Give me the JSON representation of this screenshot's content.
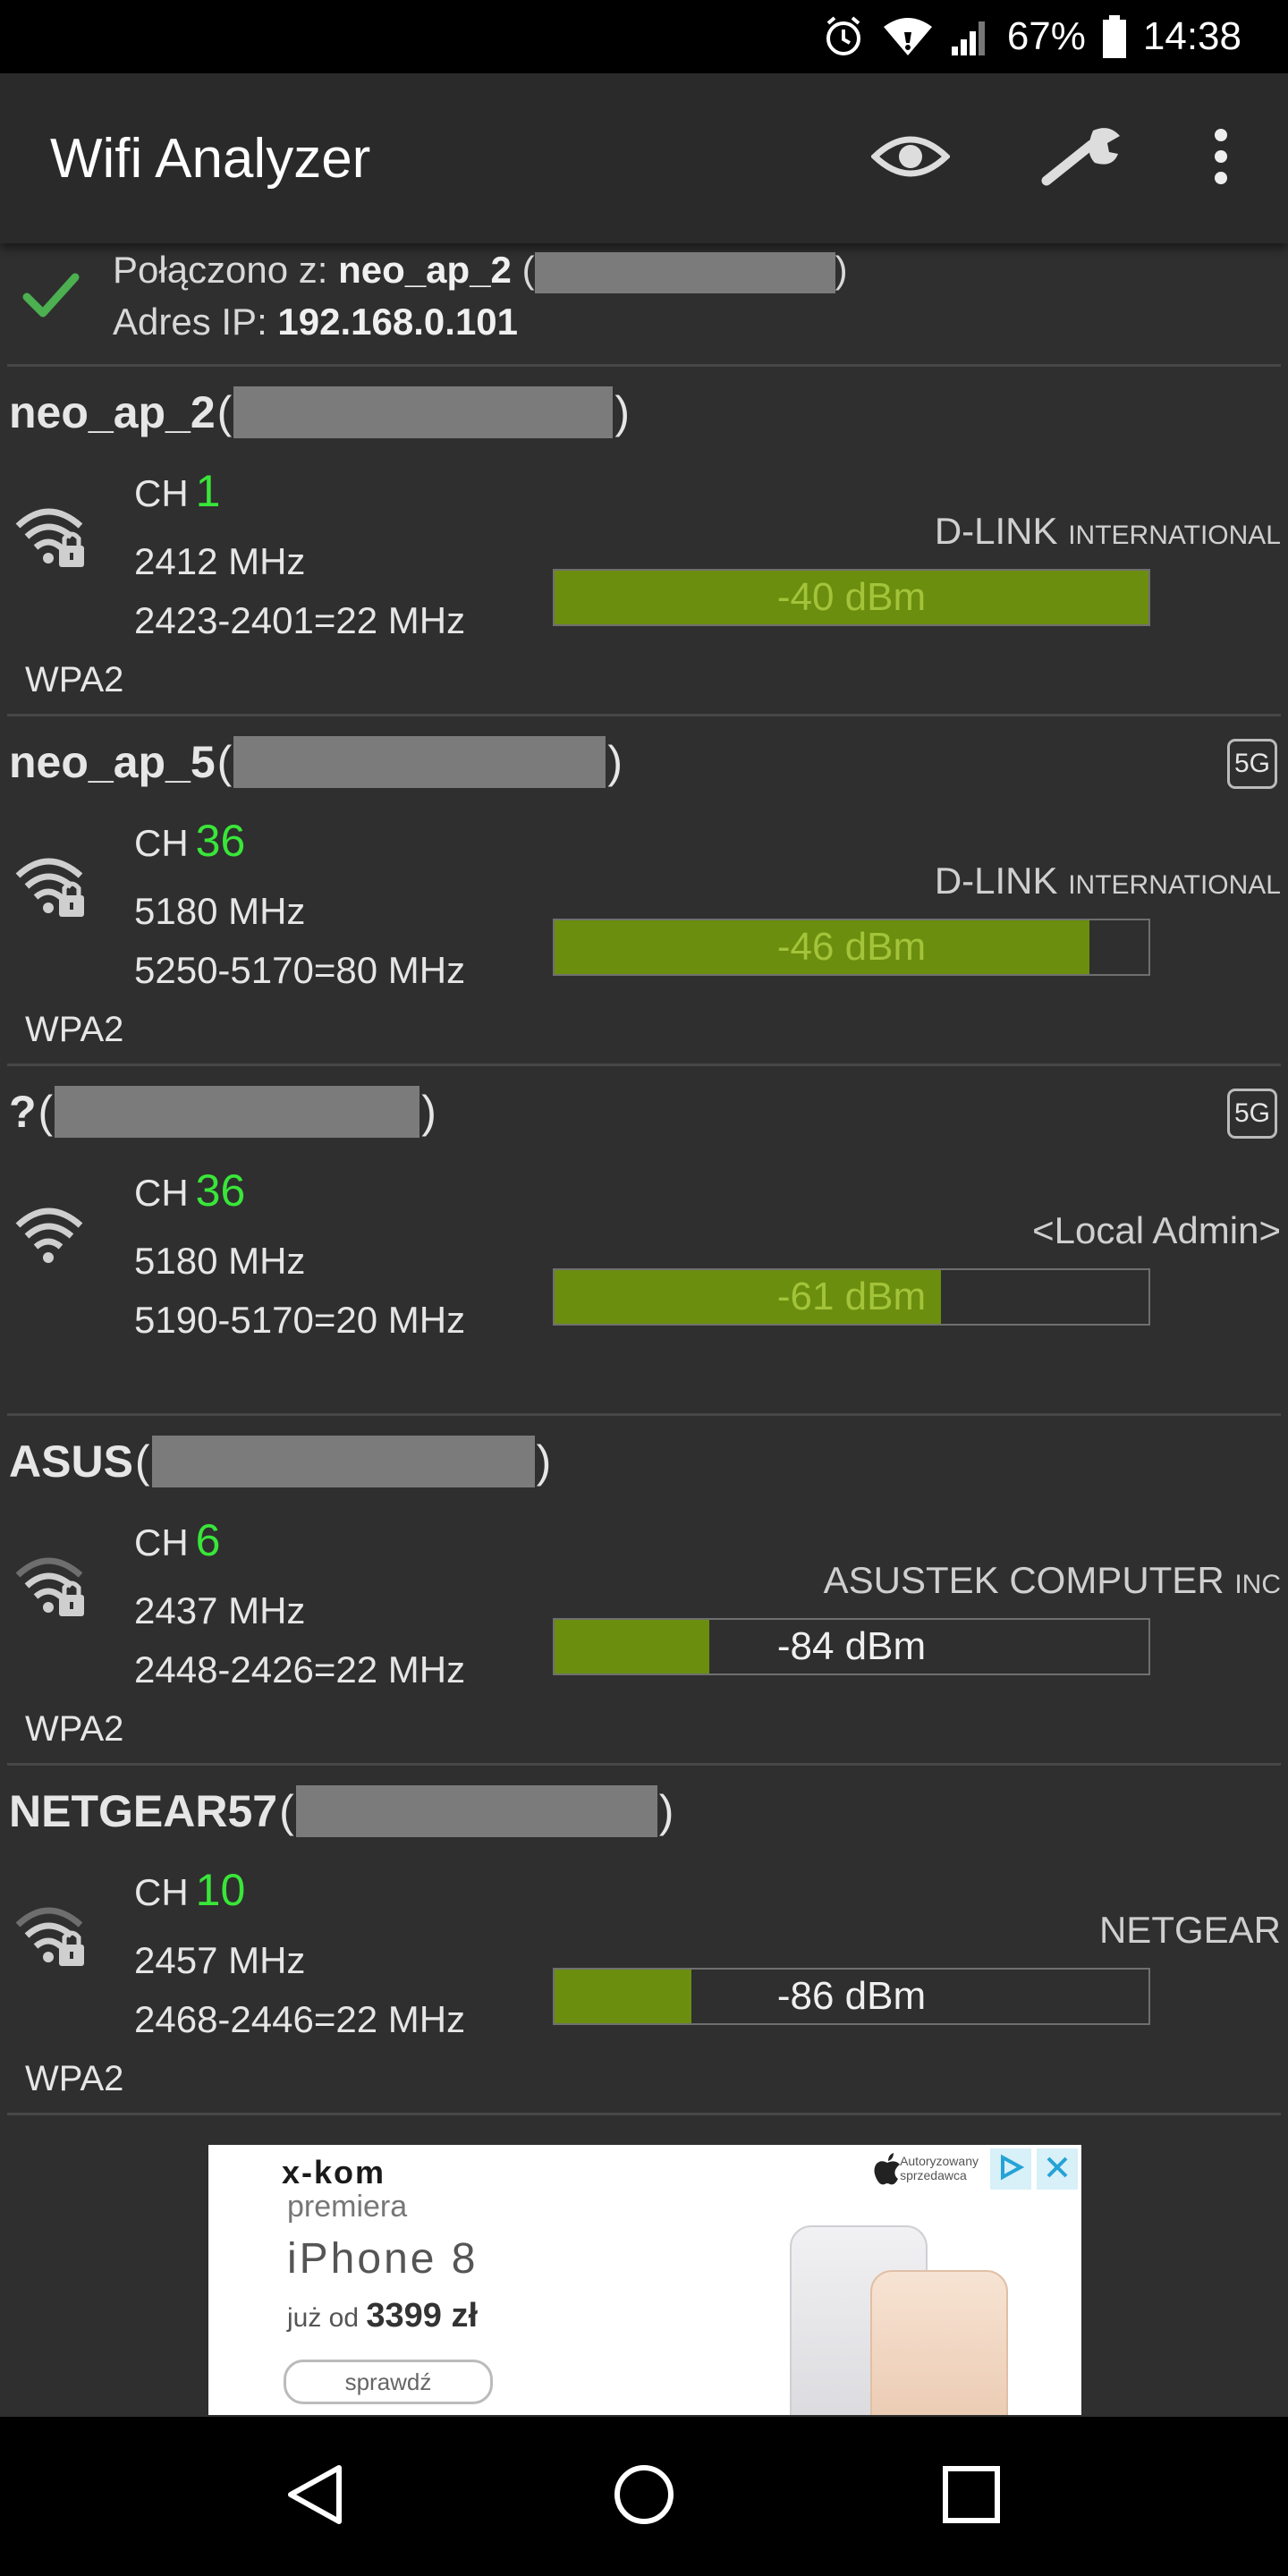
{
  "status_bar": {
    "battery": "67%",
    "time": "14:38",
    "icons": [
      "alarm-icon",
      "wifi-icon",
      "signal-icon",
      "battery-icon"
    ]
  },
  "toolbar": {
    "title": "Wifi Analyzer",
    "icons": [
      "eye-icon",
      "wrench-icon",
      "more-vert-icon"
    ]
  },
  "connection": {
    "connected_label": "Połączono z:",
    "connected_ssid": "neo_ap_2",
    "ip_label": "Adres IP:",
    "ip_value": "192.168.0.101"
  },
  "colors": {
    "accent_green": "#39e639",
    "bar_fill": "#6b8e0f",
    "bar_label_in_fill": "#a3c33a"
  },
  "networks": [
    {
      "ssid": "neo_ap_2",
      "badge": "",
      "ch_label": "CH",
      "channel": "1",
      "frequency": "2412 MHz",
      "range": "2423-2401=22 MHz",
      "security": "WPA2",
      "vendor": "D-LINK",
      "vendor_suffix": "INTERNATIONAL",
      "signal": "-40 dBm",
      "signal_fill": 1.0,
      "locked": true
    },
    {
      "ssid": "neo_ap_5",
      "badge": "5G",
      "ch_label": "CH",
      "channel": "36",
      "frequency": "5180 MHz",
      "range": "5250-5170=80 MHz",
      "security": "WPA2",
      "vendor": "D-LINK",
      "vendor_suffix": "INTERNATIONAL",
      "signal": "-46 dBm",
      "signal_fill": 0.9,
      "locked": true
    },
    {
      "ssid": "?",
      "badge": "5G",
      "ch_label": "CH",
      "channel": "36",
      "frequency": "5180 MHz",
      "range": "5190-5170=20 MHz",
      "security": "",
      "vendor": "<Local Admin>",
      "vendor_suffix": "",
      "signal": "-61 dBm",
      "signal_fill": 0.65,
      "locked": false
    },
    {
      "ssid": "ASUS",
      "badge": "",
      "ch_label": "CH",
      "channel": "6",
      "frequency": "2437 MHz",
      "range": "2448-2426=22 MHz",
      "security": "WPA2",
      "vendor": "ASUSTEK COMPUTER",
      "vendor_suffix": "INC",
      "signal": "-84 dBm",
      "signal_fill": 0.26,
      "locked": true
    },
    {
      "ssid": "NETGEAR57",
      "badge": "",
      "ch_label": "CH",
      "channel": "10",
      "frequency": "2457 MHz",
      "range": "2468-2446=22 MHz",
      "security": "WPA2",
      "vendor": "NETGEAR",
      "vendor_suffix": "",
      "signal": "-86 dBm",
      "signal_fill": 0.23,
      "locked": true
    }
  ],
  "ad": {
    "brand": "x-kom",
    "seller_line1": "Autoryzowany",
    "seller_line2": "sprzedawca",
    "premiera": "premiera",
    "product": "iPhone 8",
    "price_prefix": "już od",
    "price": "3399 zł",
    "cta": "sprawdź"
  },
  "navbar": {
    "icons": [
      "back-icon",
      "home-icon",
      "recents-icon"
    ]
  }
}
